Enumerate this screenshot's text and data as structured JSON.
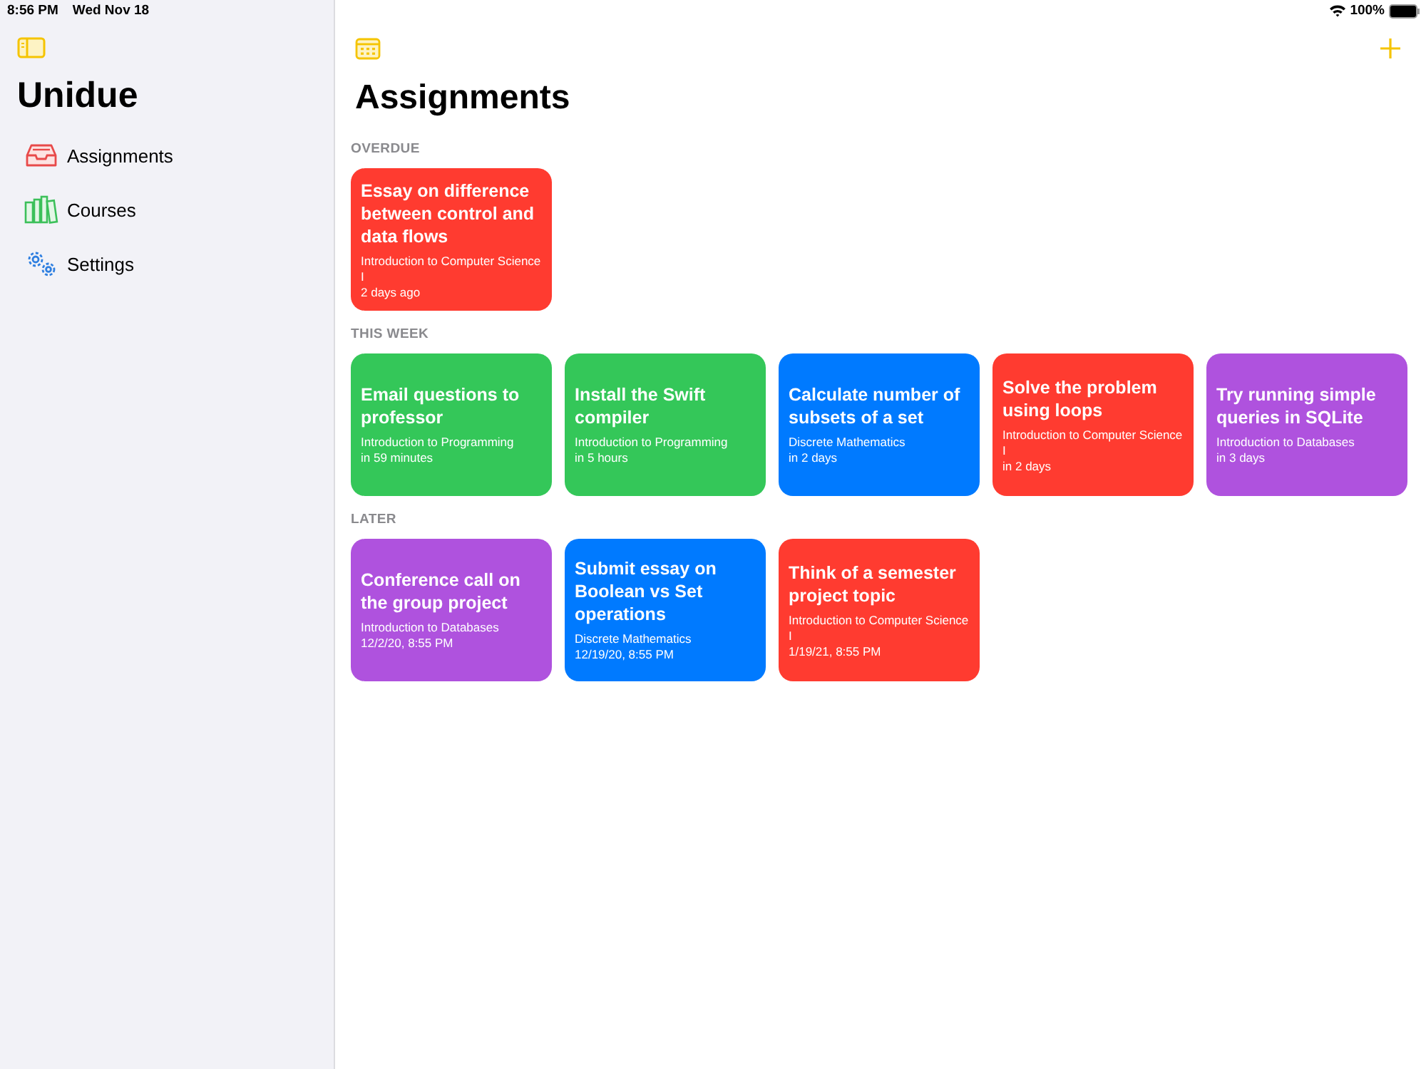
{
  "status_bar": {
    "time": "8:56 PM",
    "date": "Wed Nov 18",
    "battery": "100%"
  },
  "sidebar": {
    "title": "Unidue",
    "items": [
      {
        "label": "Assignments",
        "kind": "assignments"
      },
      {
        "label": "Courses",
        "kind": "courses"
      },
      {
        "label": "Settings",
        "kind": "settings"
      }
    ]
  },
  "main": {
    "title": "Assignments",
    "sections": [
      {
        "heading": "OVERDUE",
        "cards": [
          {
            "title": "Essay on difference between control and data flows",
            "course": "Introduction to Computer Science I",
            "due": "2 days ago",
            "color": "#ff3b30"
          }
        ]
      },
      {
        "heading": "THIS WEEK",
        "cards": [
          {
            "title": "Email questions to professor",
            "course": "Introduction to Programming",
            "due": "in 59 minutes",
            "color": "#34c759"
          },
          {
            "title": "Install the Swift compiler",
            "course": "Introduction to Programming",
            "due": "in 5 hours",
            "color": "#34c759"
          },
          {
            "title": "Calculate number of subsets of a set",
            "course": "Discrete Mathematics",
            "due": "in 2 days",
            "color": "#007aff"
          },
          {
            "title": "Solve the problem using loops",
            "course": "Introduction to Computer Science I",
            "due": "in 2 days",
            "color": "#ff3b30"
          },
          {
            "title": "Try running simple queries in SQLite",
            "course": "Introduction to Databases",
            "due": "in 3 days",
            "color": "#af52de"
          }
        ]
      },
      {
        "heading": "LATER",
        "cards": [
          {
            "title": "Conference call on the group project",
            "course": "Introduction to Databases",
            "due": "12/2/20, 8:55 PM",
            "color": "#af52de"
          },
          {
            "title": "Submit essay on Boolean vs Set operations",
            "course": "Discrete Mathematics",
            "due": "12/19/20, 8:55 PM",
            "color": "#007aff"
          },
          {
            "title": "Think of a semester project topic",
            "course": "Introduction to Computer Science I",
            "due": "1/19/21, 8:55 PM",
            "color": "#ff3b30"
          }
        ]
      }
    ]
  }
}
